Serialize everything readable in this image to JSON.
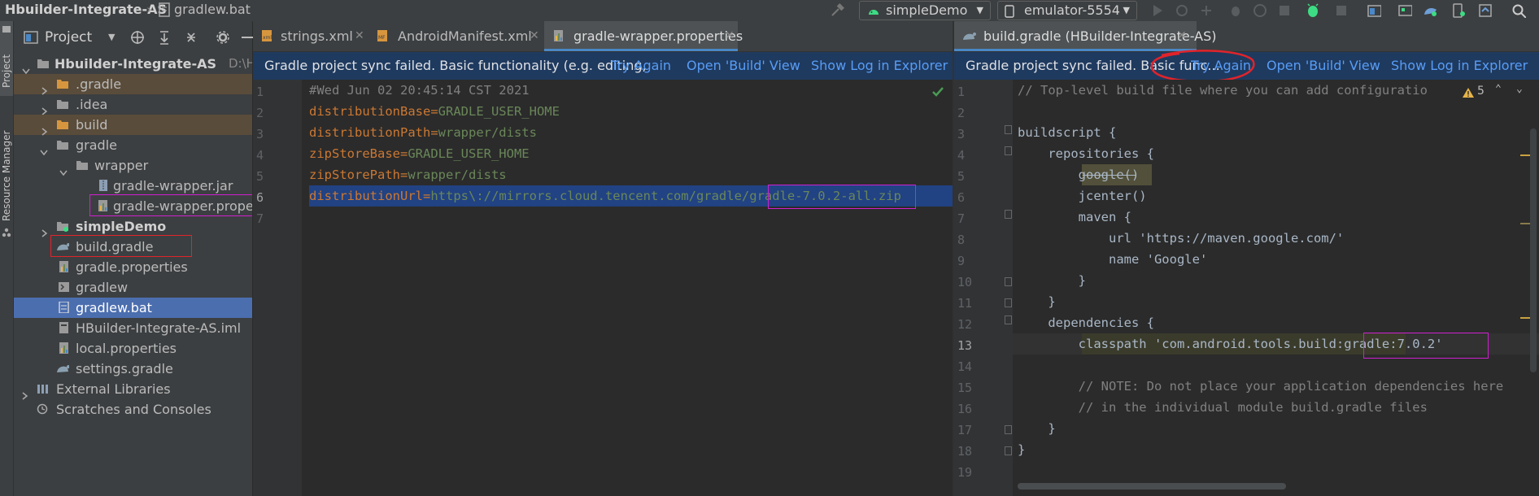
{
  "breadcrumb": {
    "project": "Hbuilder-Integrate-AS",
    "file": "gradlew.bat"
  },
  "toolbar": {
    "run_config": "simpleDemo",
    "device": "emulator-5554"
  },
  "left_tool_window": {
    "project_label": "Project",
    "resource_manager_label": "Resource Manager"
  },
  "project_panel": {
    "title": "Project",
    "root_name": "Hbuilder-Integrate-AS",
    "root_path": "D:\\HBuil",
    "items": [
      {
        "label": ".gradle"
      },
      {
        "label": ".idea"
      },
      {
        "label": "build"
      },
      {
        "label": "gradle"
      },
      {
        "label": "wrapper"
      },
      {
        "label": "gradle-wrapper.jar"
      },
      {
        "label": "gradle-wrapper.properties"
      },
      {
        "label": "simpleDemo"
      },
      {
        "label": "build.gradle"
      },
      {
        "label": "gradle.properties"
      },
      {
        "label": "gradlew"
      },
      {
        "label": "gradlew.bat"
      },
      {
        "label": "HBuilder-Integrate-AS.iml"
      },
      {
        "label": "local.properties"
      },
      {
        "label": "settings.gradle"
      },
      {
        "label": "External Libraries"
      },
      {
        "label": "Scratches and Consoles"
      }
    ]
  },
  "tabs_left": [
    {
      "label": "strings.xml"
    },
    {
      "label": "AndroidManifest.xml"
    },
    {
      "label": "gradle-wrapper.properties"
    }
  ],
  "tabs_right": [
    {
      "label": "build.gradle (HBuilder-Integrate-AS)"
    }
  ],
  "banner_left": {
    "message": "Gradle project sync failed. Basic functionality (e.g. editing,",
    "try_again": "Try Again",
    "open_build": "Open 'Build' View",
    "show_log": "Show Log in Explorer"
  },
  "banner_right": {
    "message": "Gradle project sync failed. Basic func...",
    "try_again": "Try Again",
    "open_build": "Open 'Build' View",
    "show_log": "Show Log in Explorer"
  },
  "left_editor": {
    "line_numbers": [
      "1",
      "2",
      "3",
      "4",
      "5",
      "6",
      "7"
    ],
    "lines": [
      {
        "key": "#Wed Jun 02 20:45:14 CST 2021",
        "eq": "",
        "value": ""
      },
      {
        "key": "distributionBase",
        "eq": "=",
        "value": "GRADLE_USER_HOME"
      },
      {
        "key": "distributionPath",
        "eq": "=",
        "value": "wrapper/dists"
      },
      {
        "key": "zipStoreBase",
        "eq": "=",
        "value": "GRADLE_USER_HOME"
      },
      {
        "key": "zipStorePath",
        "eq": "=",
        "value": "wrapper/dists"
      },
      {
        "key": "distributionUrl",
        "eq": "=",
        "value": "https\\://mirrors.cloud.tencent.com/gradle/gradle-7.0.2-all.zip"
      }
    ]
  },
  "right_editor": {
    "line_numbers": [
      "1",
      "2",
      "3",
      "4",
      "5",
      "6",
      "7",
      "8",
      "9",
      "10",
      "11",
      "12",
      "13",
      "14",
      "15",
      "16",
      "17",
      "18",
      "19"
    ],
    "warning_count": "5",
    "lines": [
      "// Top-level build file where you can add configuratio",
      "",
      "buildscript {",
      "    repositories {",
      "        google()",
      "        jcenter()",
      "        maven {",
      "            url 'https://maven.google.com/'",
      "            name 'Google'",
      "        }",
      "    }",
      "    dependencies {",
      "        classpath 'com.android.tools.build:gradle:7.0.2'",
      "",
      "        // NOTE: Do not place your application dependencies here",
      "        // in the individual module build.gradle files",
      "    }",
      "}",
      ""
    ]
  }
}
